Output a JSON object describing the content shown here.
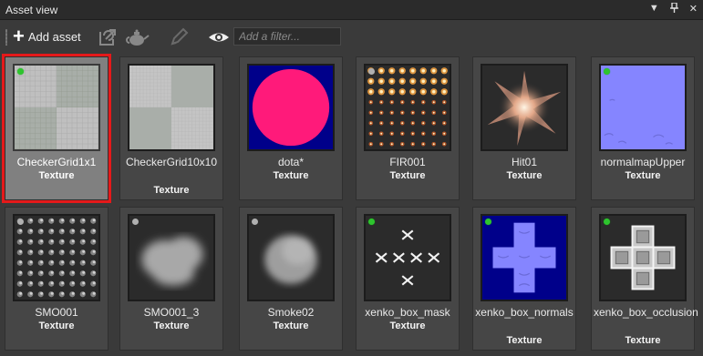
{
  "panel": {
    "title": "Asset view",
    "controls": [
      "dropdown-icon",
      "pin-icon",
      "close-icon"
    ]
  },
  "toolbar": {
    "add_label": "Add asset",
    "filter_placeholder": "Add a filter...",
    "icons": [
      "plus-icon",
      "import-icon",
      "teapot-icon",
      "pencil-icon",
      "eye-icon"
    ]
  },
  "assets": [
    {
      "name": "CheckerGrid1x1",
      "type": "Texture",
      "status": "green",
      "selected": true
    },
    {
      "name": "CheckerGrid10x10",
      "type": "Texture",
      "status": "none",
      "selected": false
    },
    {
      "name": "dota*",
      "type": "Texture",
      "status": "none",
      "selected": false
    },
    {
      "name": "FIR001",
      "type": "Texture",
      "status": "gray",
      "selected": false
    },
    {
      "name": "Hit01",
      "type": "Texture",
      "status": "gray",
      "selected": false
    },
    {
      "name": "normalmapUpper",
      "type": "Texture",
      "status": "green",
      "selected": false
    },
    {
      "name": "SMO001",
      "type": "Texture",
      "status": "gray",
      "selected": false
    },
    {
      "name": "SMO001_3",
      "type": "Texture",
      "status": "gray",
      "selected": false
    },
    {
      "name": "Smoke02",
      "type": "Texture",
      "status": "gray",
      "selected": false
    },
    {
      "name": "xenko_box_mask",
      "type": "Texture",
      "status": "green",
      "selected": false
    },
    {
      "name": "xenko_box_normals",
      "type": "Texture",
      "status": "green",
      "selected": false
    },
    {
      "name": "xenko_box_occlusion",
      "type": "Texture",
      "status": "green",
      "selected": false
    }
  ],
  "colors": {
    "selection_border": "#e5191a",
    "status_green": "#2ec42e",
    "status_gray": "#b0b0b0",
    "dota_bg": "#00008a",
    "dota_circle": "#ff1a7a",
    "normal_blue": "#8080ff"
  }
}
